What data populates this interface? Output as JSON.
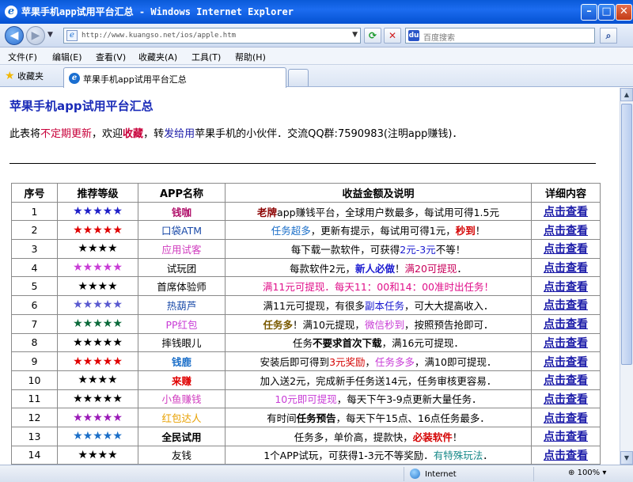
{
  "window": {
    "title": "苹果手机app试用平台汇总 - Windows Internet Explorer"
  },
  "address_bar": {
    "url": "http://www.kuangso.net/ios/apple.htm",
    "search_placeholder": "百度搜索"
  },
  "menu": [
    "文件(F)",
    "编辑(E)",
    "查看(V)",
    "收藏夹(A)",
    "工具(T)",
    "帮助(H)"
  ],
  "favorites_label": "收藏夹",
  "tab": {
    "label": "苹果手机app试用平台汇总"
  },
  "page": {
    "title": "苹果手机app试用平台汇总",
    "intro": {
      "p1": "此表将",
      "p2": "不定期更新",
      "p3": "，欢迎",
      "p4": "收藏",
      "p5": "，转",
      "p6": "发给用",
      "p7": "苹果手机的小伙伴．交流QQ群:7590983(注明app赚钱)．"
    }
  },
  "table": {
    "headers": [
      "序号",
      "推荐等级",
      "APP名称",
      "收益金额及说明",
      "详细内容"
    ],
    "rows": [
      {
        "num": "1",
        "stars": "★★★★★",
        "star_color": "#1e1ec8",
        "name": "钱咖",
        "name_color": "#b0106a",
        "name_bold": true,
        "desc": [
          {
            "t": "老牌",
            "c": "#8b0000",
            "b": true
          },
          {
            "t": "app赚钱平台，全球用户数最多，每试用可得1.5元",
            "c": "#000"
          }
        ],
        "detail": "点击查看"
      },
      {
        "num": "2",
        "stars": "★★★★★",
        "star_color": "#e00000",
        "name": "口袋ATM",
        "name_color": "#1a4aa8",
        "name_bold": false,
        "desc": [
          {
            "t": "任务超多",
            "c": "#1a6ec8"
          },
          {
            "t": "，更新有提示，每试用可得1元，",
            "c": "#000"
          },
          {
            "t": "秒到",
            "c": "#d40000",
            "b": true
          },
          {
            "t": "！",
            "c": "#000"
          }
        ],
        "detail": "点击查看"
      },
      {
        "num": "3",
        "stars": "★★★★",
        "star_color": "#000000",
        "name": "应用试客",
        "name_color": "#d03cbf",
        "name_bold": false,
        "desc": [
          {
            "t": "每下载一款软件，可获得",
            "c": "#000"
          },
          {
            "t": "2元-3元",
            "c": "#1a1ad0"
          },
          {
            "t": "不等！",
            "c": "#000"
          }
        ],
        "detail": "点击查看"
      },
      {
        "num": "4",
        "stars": "★★★★★",
        "star_color": "#c83cd6",
        "name": "试玩团",
        "name_color": "#000",
        "name_bold": false,
        "desc": [
          {
            "t": "每款软件2元，",
            "c": "#000"
          },
          {
            "t": "新人必做",
            "c": "#1a1ad0",
            "b": true
          },
          {
            "t": "！",
            "c": "#000"
          },
          {
            "t": "满20可提现",
            "c": "#c8005a"
          },
          {
            "t": "．",
            "c": "#000"
          }
        ],
        "detail": "点击查看"
      },
      {
        "num": "5",
        "stars": "★★★★",
        "star_color": "#000000",
        "name": "首席体验师",
        "name_color": "#000",
        "name_bold": false,
        "desc": [
          {
            "t": "满11元可提现．每天11：00和14：00准时出任务！",
            "c": "#e0108a"
          }
        ],
        "detail": "点击查看"
      },
      {
        "num": "6",
        "stars": "★★★★★",
        "star_color": "#5a5ad0",
        "name": "热葫芦",
        "name_color": "#1a4aa8",
        "name_bold": false,
        "desc": [
          {
            "t": "满11元可提现，有很多",
            "c": "#000"
          },
          {
            "t": "副本任务",
            "c": "#1a1ad0"
          },
          {
            "t": "，可大大提高收入．",
            "c": "#000"
          }
        ],
        "detail": "点击查看"
      },
      {
        "num": "7",
        "stars": "★★★★★",
        "star_color": "#0a6a3a",
        "name": "PP红包",
        "name_color": "#c83cd6",
        "name_bold": false,
        "desc": [
          {
            "t": "任务多",
            "c": "#7a5a00",
            "b": true
          },
          {
            "t": "！满10元提现，",
            "c": "#000"
          },
          {
            "t": "微信秒到",
            "c": "#c83cd6"
          },
          {
            "t": "，按照预告抢即可．",
            "c": "#000"
          }
        ],
        "detail": "点击查看"
      },
      {
        "num": "8",
        "stars": "★★★★★",
        "star_color": "#000000",
        "name": "摔钱眼儿",
        "name_color": "#000",
        "name_bold": false,
        "desc": [
          {
            "t": "任务",
            "c": "#000"
          },
          {
            "t": "不要求首次下载",
            "c": "#000",
            "b": true
          },
          {
            "t": "，满16元可提现．",
            "c": "#000"
          }
        ],
        "detail": "点击查看"
      },
      {
        "num": "9",
        "stars": "★★★★★",
        "star_color": "#e00000",
        "name": "钱鹿",
        "name_color": "#1a6ec8",
        "name_bold": true,
        "desc": [
          {
            "t": "安装后即可得到",
            "c": "#000"
          },
          {
            "t": "3元奖励",
            "c": "#d40000"
          },
          {
            "t": "，",
            "c": "#000"
          },
          {
            "t": "任务多多",
            "c": "#c83cd6"
          },
          {
            "t": "，满10即可提现．",
            "c": "#000"
          }
        ],
        "detail": "点击查看"
      },
      {
        "num": "10",
        "stars": "★★★★",
        "star_color": "#000000",
        "name": "来赚",
        "name_color": "#e00000",
        "name_bold": true,
        "desc": [
          {
            "t": "加入送2元，完成新手任务送14元，任务审核更容易．",
            "c": "#000"
          }
        ],
        "detail": "点击查看"
      },
      {
        "num": "11",
        "stars": "★★★★★",
        "star_color": "#000000",
        "name": "小鱼赚钱",
        "name_color": "#d03cbf",
        "name_bold": false,
        "desc": [
          {
            "t": "10元即可提现",
            "c": "#c83cd6"
          },
          {
            "t": "，每天下午3-9点更新大量任务．",
            "c": "#000"
          }
        ],
        "detail": "点击查看"
      },
      {
        "num": "12",
        "stars": "★★★★★",
        "star_color": "#9a1ab8",
        "name": "红包达人",
        "name_color": "#e8a000",
        "name_bold": false,
        "desc": [
          {
            "t": "有时间",
            "c": "#000"
          },
          {
            "t": "任务预告",
            "c": "#000",
            "b": true
          },
          {
            "t": "，每天下午15点、16点任务最多．",
            "c": "#000"
          }
        ],
        "detail": "点击查看"
      },
      {
        "num": "13",
        "stars": "★★★★★",
        "star_color": "#1a6ec8",
        "name": "全民试用",
        "name_color": "#000",
        "name_bold": true,
        "desc": [
          {
            "t": "任务多，单价高，提款快，",
            "c": "#000"
          },
          {
            "t": "必装软件",
            "c": "#d40000",
            "b": true
          },
          {
            "t": "！",
            "c": "#000"
          }
        ],
        "detail": "点击查看"
      },
      {
        "num": "14",
        "stars": "★★★★",
        "star_color": "#000000",
        "name": "友钱",
        "name_color": "#000",
        "name_bold": false,
        "desc": [
          {
            "t": "1个APP试玩，可获得1-3元不等奖励．",
            "c": "#000"
          },
          {
            "t": "有特殊玩法",
            "c": "#1a8a8a"
          },
          {
            "t": "．",
            "c": "#000"
          }
        ],
        "detail": "点击查看"
      }
    ]
  },
  "status": {
    "zone": "Internet",
    "zoom": "100%"
  }
}
